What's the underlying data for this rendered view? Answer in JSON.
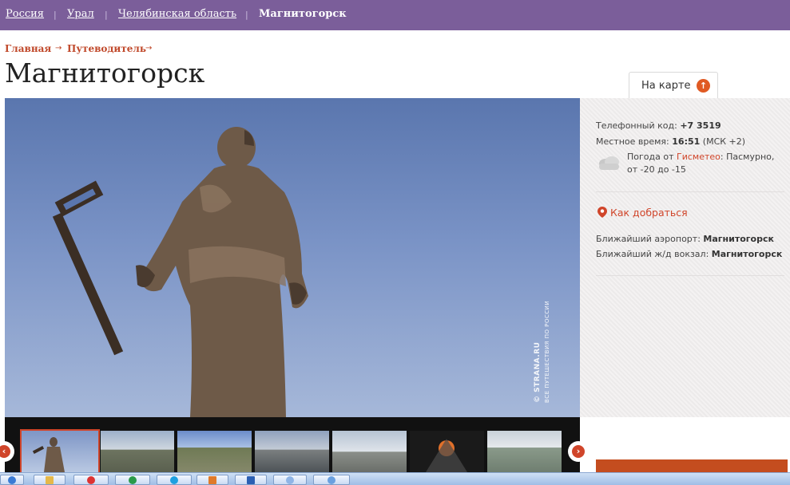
{
  "topbar": {
    "crumbs": [
      "Россия",
      "Урал",
      "Челябинская область"
    ],
    "current": "Магнитогорск",
    "separator": "|"
  },
  "breadcrumbs": [
    "Главная",
    "Путеводитель"
  ],
  "breadcrumb_arrow": "→",
  "page_title": "Магнитогорск",
  "map_tab": {
    "label": "На карте",
    "icon": "arrow-up-icon"
  },
  "photo": {
    "watermark": "© STRANA.RU",
    "watermark_sub": "ВСЕ ПУТЕШЕСТВИЯ ПО РОССИИ"
  },
  "info": {
    "phone_label": "Телефонный код:",
    "phone_value": "+7 3519",
    "time_label": "Местное время:",
    "time_value": "16:51",
    "time_zone": "(МСК +2)",
    "weather_prefix": "Погода от",
    "weather_source": "Гисметео",
    "weather_desc": ": Пасмурно,",
    "weather_range": "от -20 до -15",
    "how_to_get": "Как добраться",
    "airport_label": "Ближайший аэропорт:",
    "airport_value": "Магнитогорск",
    "station_label": "Ближайший ж/д вокзал:",
    "station_value": "Магнитогорск"
  },
  "gallery": {
    "prev_icon": "chevron-left-icon",
    "next_icon": "chevron-right-icon",
    "active_index": 0
  },
  "colors": {
    "topbar": "#7b5e9a",
    "accent": "#d0452a"
  }
}
